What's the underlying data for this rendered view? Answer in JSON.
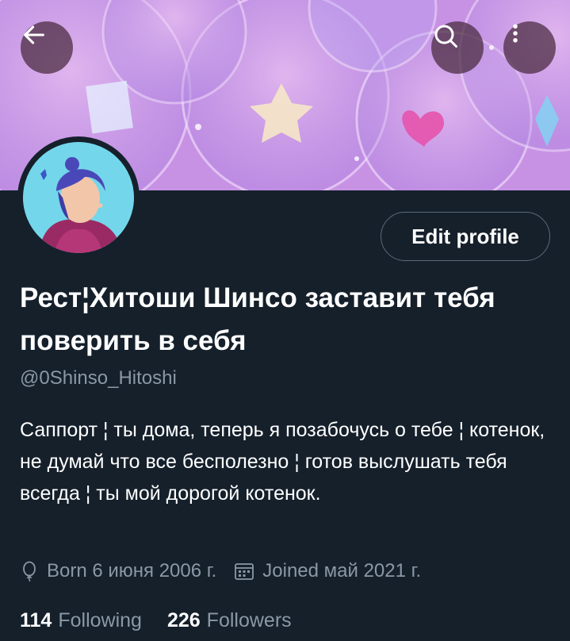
{
  "header": {
    "back_icon": "arrow-left-icon",
    "search_icon": "search-icon",
    "more_icon": "more-vertical-icon"
  },
  "profile": {
    "edit_label": "Edit profile",
    "display_name": "Рест¦Хитоши Шинсо заставит тебя поверить в себя",
    "handle": "@0Shinso_Hitoshi",
    "bio": "Саппорт ¦ ты дома, теперь я позабочусь о тебе ¦ котенок, не думай что все бесполезно ¦ готов выслушать тебя всегда ¦ ты мой дорогой котенок.",
    "born": "Born 6 июня 2006 г.",
    "joined": "Joined май 2021 г."
  },
  "stats": {
    "following_count": "114",
    "following_label": "Following",
    "followers_count": "226",
    "followers_label": "Followers"
  },
  "colors": {
    "background": "#15202b",
    "secondary_text": "#8b98a5",
    "border": "#5b6b78"
  }
}
